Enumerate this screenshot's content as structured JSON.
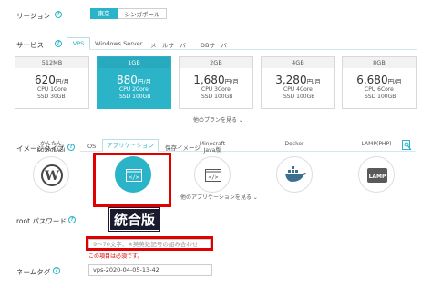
{
  "region": {
    "label": "リージョン",
    "options": [
      "東京",
      "シンガポール"
    ],
    "selected": "東京"
  },
  "service": {
    "label": "サービス",
    "tabs": [
      "VPS",
      "Windows Server",
      "メールサーバー",
      "DBサーバー"
    ],
    "active_tab": "VPS"
  },
  "plans": [
    {
      "head": "512MB",
      "price": "620",
      "unit": "円/月",
      "cpu_label": "CPU",
      "cpu": "1Core",
      "ssd_label": "SSD",
      "ssd": "30GB",
      "selected": false
    },
    {
      "head": "1GB",
      "price": "880",
      "unit": "円/月",
      "cpu_label": "CPU",
      "cpu": "2Core",
      "ssd_label": "SSD",
      "ssd": "100GB",
      "selected": true
    },
    {
      "head": "2GB",
      "price": "1,680",
      "unit": "円/月",
      "cpu_label": "CPU",
      "cpu": "3Core",
      "ssd_label": "SSD",
      "ssd": "100GB",
      "selected": false
    },
    {
      "head": "4GB",
      "price": "3,280",
      "unit": "円/月",
      "cpu_label": "CPU",
      "cpu": "4Core",
      "ssd_label": "SSD",
      "ssd": "100GB",
      "selected": false
    },
    {
      "head": "8GB",
      "price": "6,680",
      "unit": "円/月",
      "cpu_label": "CPU",
      "cpu": "6Core",
      "ssd_label": "SSD",
      "ssd": "100GB",
      "selected": false
    }
  ],
  "plans_more": "他のプランを見る ⌄",
  "image_type": {
    "label": "イメージタイプ",
    "tabs": [
      "OS",
      "アプリケーション",
      "保存イメージ"
    ],
    "active_tab": "アプリケーション"
  },
  "apps": [
    {
      "name": "かんたん\nKUSANAGI",
      "icon": "wordpress-icon",
      "selected": false
    },
    {
      "name": "Minecraft\n統合版",
      "icon": "code-window-icon",
      "selected": true
    },
    {
      "name": "Minecraft\nJava版",
      "icon": "code-window-icon",
      "selected": false
    },
    {
      "name": "Docker",
      "icon": "docker-icon",
      "selected": false
    },
    {
      "name": "LAMP(PHP)",
      "icon": "lamp-icon",
      "selected": false
    }
  ],
  "callout": "統合版",
  "apps_more": "他のアプリケーションを見る ⌄",
  "root_password": {
    "label": "root パスワード",
    "placeholder": "9～70文字、※英英数記号の組み合わせ",
    "error": "この項目は必須です。"
  },
  "name_tag": {
    "label": "ネームタグ",
    "value": "vps-2020-04-05-13-42"
  },
  "colors": {
    "accent": "#2bb4c8",
    "highlight": "#e00000"
  }
}
